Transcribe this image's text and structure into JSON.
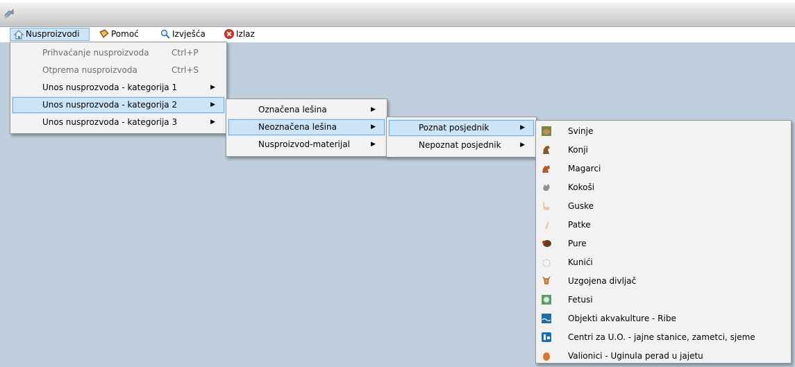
{
  "menubar": {
    "items": [
      {
        "label": "Nusproizvodi",
        "icon": "house-icon"
      },
      {
        "label": "Pomoć",
        "icon": "book-icon"
      },
      {
        "label": "Izvješća",
        "icon": "magnifier-icon"
      },
      {
        "label": "Izlaz",
        "icon": "close-circle-icon"
      }
    ]
  },
  "menu1": {
    "items": [
      {
        "label": "Prihvaćanje nusproizvoda",
        "shortcut": "Ctrl+P",
        "disabled": true
      },
      {
        "label": "Otprema nusproizvoda",
        "shortcut": "Ctrl+S",
        "disabled": true
      },
      {
        "label": "Unos nusprozvoda - kategorija 1",
        "submenu": true
      },
      {
        "label": "Unos nusprozvoda - kategorija 2",
        "submenu": true,
        "highlighted": true
      },
      {
        "label": "Unos nusprozvoda - kategorija 3",
        "submenu": true
      }
    ]
  },
  "menu2": {
    "items": [
      {
        "label": "Označena lešina",
        "submenu": true
      },
      {
        "label": "Neoznačena lešina",
        "submenu": true,
        "highlighted": true
      },
      {
        "label": "Nusproizvod-materijal",
        "submenu": true
      }
    ]
  },
  "menu3": {
    "items": [
      {
        "label": "Poznat posjednik",
        "submenu": true,
        "highlighted": true
      },
      {
        "label": "Nepoznat posjednik",
        "submenu": true
      }
    ]
  },
  "menu4": {
    "items": [
      {
        "label": "Svinje",
        "icon": "pig-icon"
      },
      {
        "label": "Konji",
        "icon": "horse-icon"
      },
      {
        "label": "Magarci",
        "icon": "donkey-icon"
      },
      {
        "label": "Kokoši",
        "icon": "chicken-icon"
      },
      {
        "label": "Guske",
        "icon": "goose-icon"
      },
      {
        "label": "Patke",
        "icon": "duck-icon"
      },
      {
        "label": "Pure",
        "icon": "turkey-icon"
      },
      {
        "label": "Kunići",
        "icon": "rabbit-icon"
      },
      {
        "label": "Uzgojena divljač",
        "icon": "deer-icon"
      },
      {
        "label": "Fetusi",
        "icon": "fetus-icon"
      },
      {
        "label": "Objekti akvakulture - Ribe",
        "icon": "fish-icon"
      },
      {
        "label": "Centri za U.O. - jajne stanice, zametci, sjeme",
        "icon": "lab-icon"
      },
      {
        "label": "Valionici - Uginula perad u jajetu",
        "icon": "egg-icon"
      }
    ]
  },
  "colors": {
    "client_bg": "#bfcfdd",
    "menu_bg": "#f2f2f2",
    "highlight_bg": "#cce4f7",
    "highlight_border": "#77b0df"
  }
}
